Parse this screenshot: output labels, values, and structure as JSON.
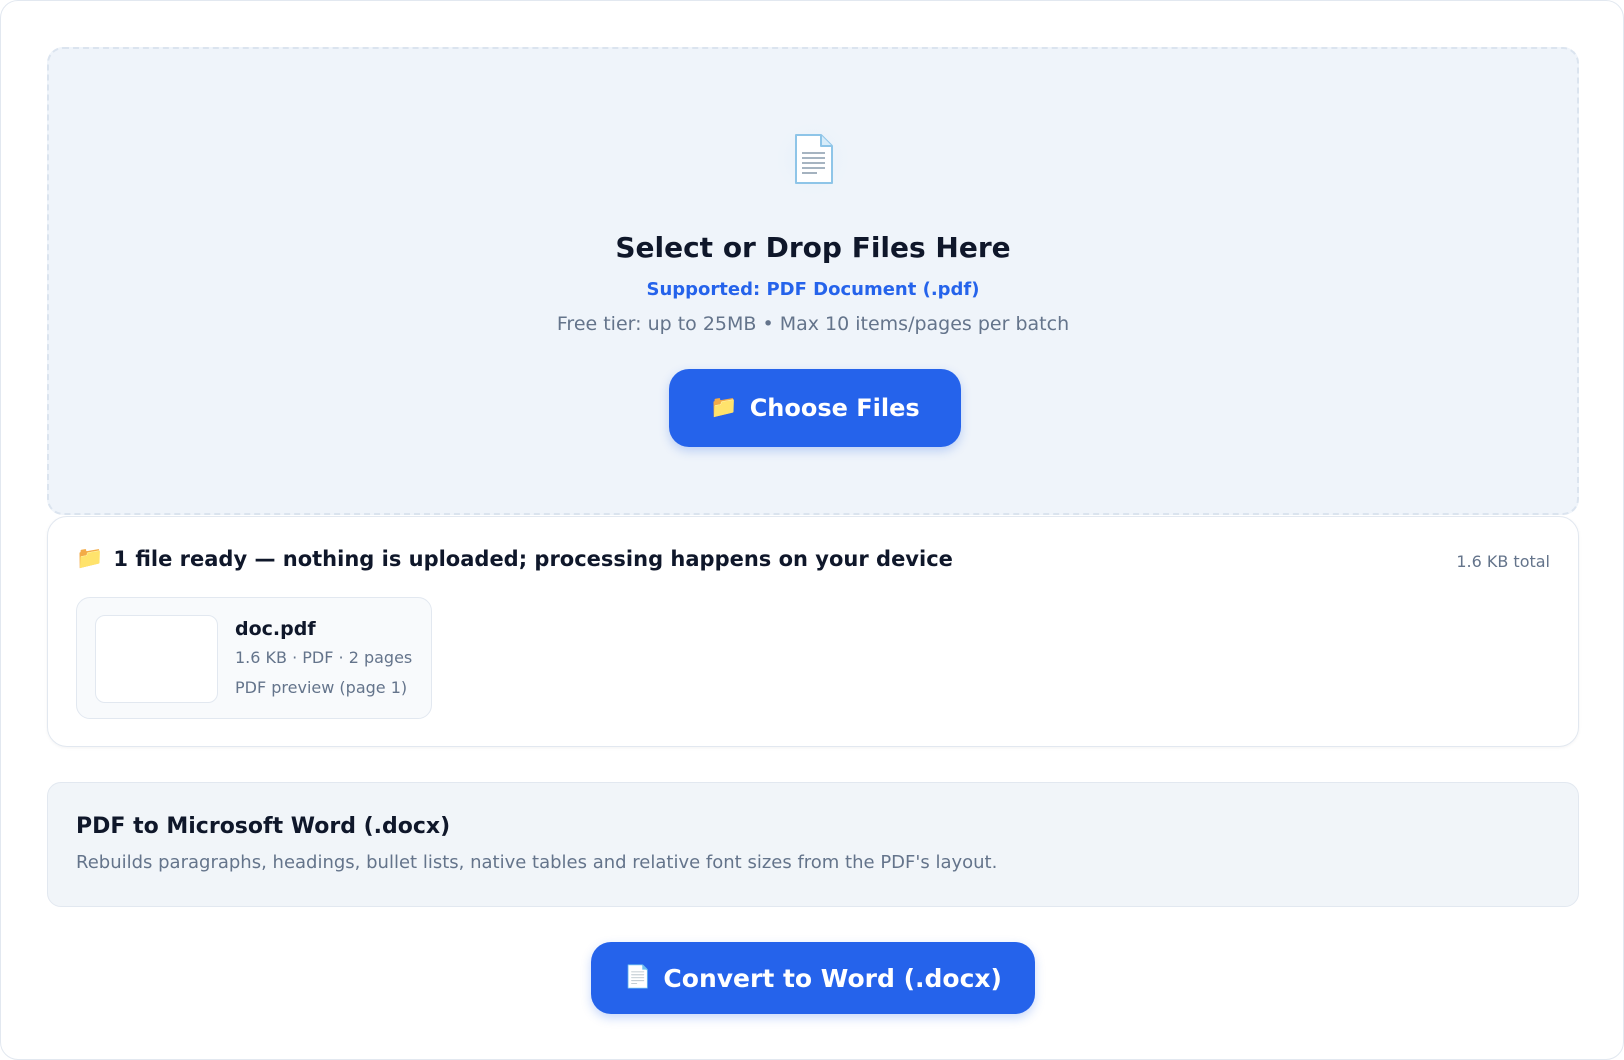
{
  "dropzone": {
    "icon": "document-icon",
    "title": "Select or Drop Files Here",
    "supported": "Supported: PDF Document (.pdf)",
    "limits": "Free tier: up to 25MB • Max 10 items/pages per batch",
    "choose_button": {
      "icon": "folder-icon",
      "icon_glyph": "📁",
      "label": "Choose Files"
    }
  },
  "files": {
    "header_icon": "folder-icon",
    "header_icon_glyph": "📁",
    "header": "1 file ready — nothing is uploaded; processing happens on your device",
    "total": "1.6 KB total",
    "items": [
      {
        "name": "doc.pdf",
        "meta": "1.6 KB · PDF · 2 pages",
        "preview": "PDF preview (page 1)"
      }
    ]
  },
  "conversion": {
    "title": "PDF to Microsoft Word (.docx)",
    "description": "Rebuilds paragraphs, headings, bullet lists, native tables and relative font sizes from the PDF's layout."
  },
  "convert_button": {
    "icon": "document-icon",
    "icon_glyph": "📄",
    "label": "Convert to Word (.docx)"
  },
  "colors": {
    "accent": "#2563eb",
    "dropzone_bg": "#eff4fa",
    "muted_text": "#64748b",
    "heading_text": "#0f172a"
  }
}
